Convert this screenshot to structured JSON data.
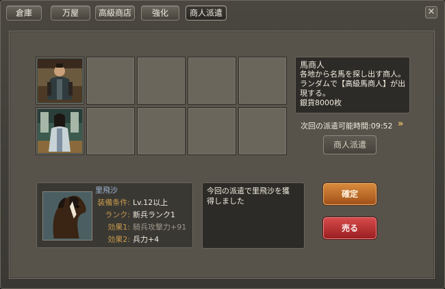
{
  "tabs": [
    {
      "label": "倉庫"
    },
    {
      "label": "万屋"
    },
    {
      "label": "高級商店"
    },
    {
      "label": "強化"
    },
    {
      "label": "商人派遣"
    }
  ],
  "close_label": "✕",
  "merchant": {
    "title": "馬商人",
    "line1": "各地から名馬を探し出す商人。",
    "line2": "ランダムで【高級馬商人】が出",
    "line3": "現する。",
    "cost": "銀貨8000枚"
  },
  "timer": "次回の派遣可能時間:09:52",
  "arrows": "»",
  "dispatch_label": "商人派遣",
  "horse": {
    "name": "里飛沙",
    "labels": [
      "装備条件:",
      "ランク:",
      "効果1:",
      "効果2:"
    ],
    "values": [
      "Lv.12以上",
      "新兵ランク1",
      "騎兵攻撃力+91",
      "兵力+4"
    ]
  },
  "message": {
    "line1": "今回の派遣で里飛沙を獲",
    "line2": "得しました"
  },
  "confirm_label": "確定",
  "sell_label": "売る"
}
